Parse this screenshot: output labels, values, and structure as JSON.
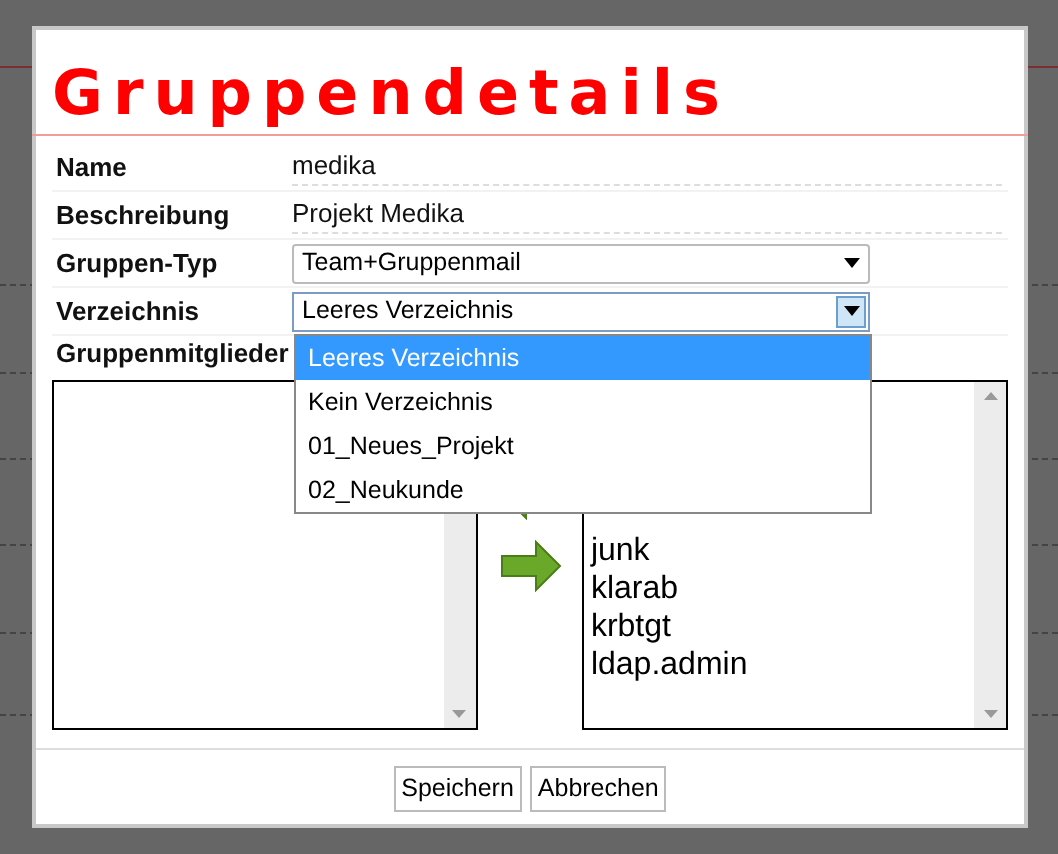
{
  "dialog": {
    "title": "Gruppendetails",
    "fields": [
      {
        "kind": "text",
        "label": "Name",
        "value": "medika"
      },
      {
        "kind": "text",
        "label": "Beschreibung",
        "value": "Projekt Medika"
      },
      {
        "kind": "select",
        "label": "Gruppen-Typ",
        "value": "Team+Gruppenmail",
        "open": false
      },
      {
        "kind": "select",
        "label": "Verzeichnis",
        "value": "Leeres Verzeichnis",
        "open": true,
        "options": [
          {
            "label": "Leeres Verzeichnis",
            "selected": true
          },
          {
            "label": "Kein Verzeichnis",
            "selected": false
          },
          {
            "label": "01_Neues_Projekt",
            "selected": false
          },
          {
            "label": "02_Neukunde",
            "selected": false
          }
        ]
      }
    ],
    "members": {
      "label": "Gruppenmitglieder",
      "available_items": [
        "junk",
        "klarab",
        "krbtgt",
        "ldap.admin"
      ]
    },
    "buttons": [
      "Speichern",
      "Abbrechen"
    ]
  }
}
